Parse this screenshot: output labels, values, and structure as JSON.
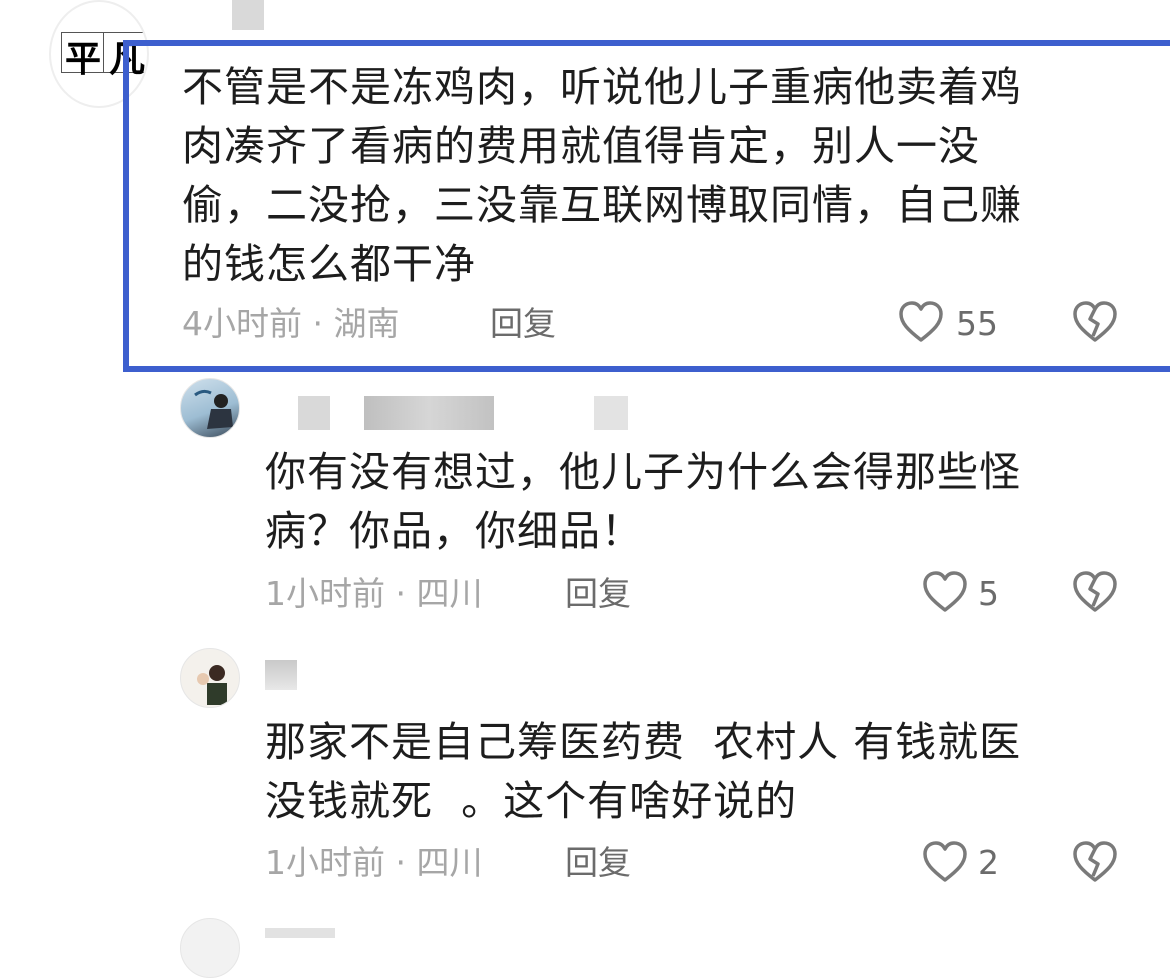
{
  "comments": [
    {
      "avatar_text": [
        "平",
        "凡"
      ],
      "lines": [
        "不管是不是冻鸡肉，听说他儿子重病他卖着鸡",
        "肉凑齐了看病的费用就值得肯定，别人一没",
        "偷，二没抢，三没靠互联网博取同情，自己赚",
        "的钱怎么都干净"
      ],
      "meta": "4小时前 · 湖南",
      "reply_label": "回复",
      "likes": "55"
    },
    {
      "lines": [
        "你有没有想过，他儿子为什么会得那些怪",
        "病？你品，你细品！"
      ],
      "meta": "1小时前 · 四川",
      "reply_label": "回复",
      "likes": "5"
    },
    {
      "lines": [
        "那家不是自己筹医药费  农村人 有钱就医",
        "没钱就死  。这个有啥好说的"
      ],
      "meta": "1小时前 · 四川",
      "reply_label": "回复",
      "likes": "2"
    }
  ],
  "icons": {
    "like": "heart-outline-icon",
    "dislike": "broken-heart-icon"
  },
  "colors": {
    "highlight": "#3d5fce",
    "meta_text": "#a6a6a6",
    "reply_text": "#6b6b6b"
  }
}
